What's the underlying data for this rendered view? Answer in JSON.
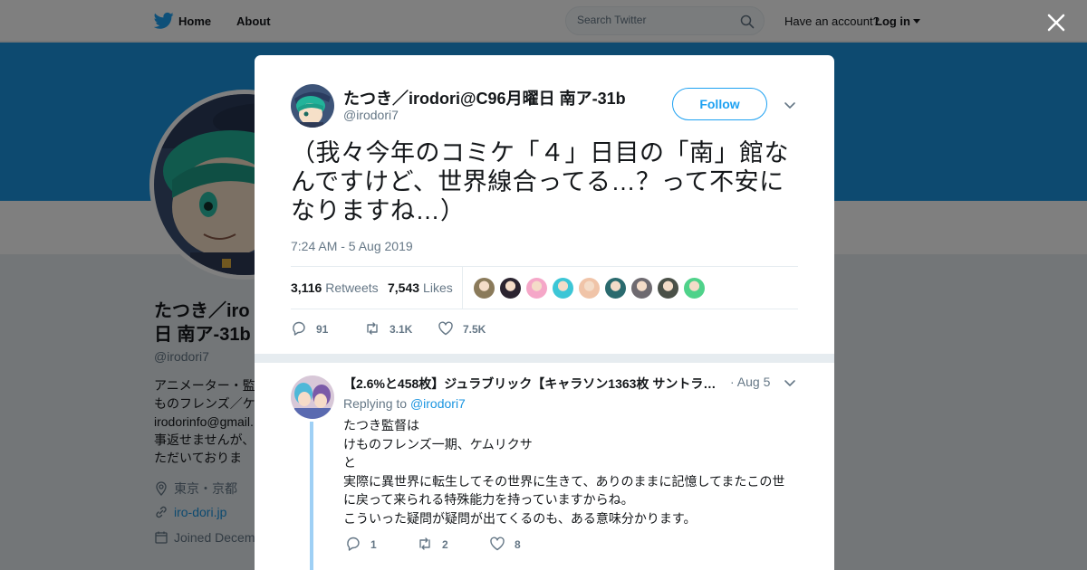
{
  "nav": {
    "home_label": "Home",
    "about_label": "About",
    "search_placeholder": "Search Twitter",
    "account_prompt": "Have an account?",
    "login_label": "Log in"
  },
  "background_profile": {
    "name_line1": "たつき／iro",
    "name_line2": "日 南ア-31b",
    "handle": "@irodori7",
    "bio_lines": [
      "アニメーター・監",
      "ものフレンズ／ケ",
      "irodorinfo@gmail.",
      "事返せませんが、",
      "ただいておりま"
    ],
    "location": "東京・京都",
    "website": "iro-dori.jp",
    "joined": "Joined Decem"
  },
  "tweet": {
    "author_name": "たつき／irodori@C96月曜日 南ア-31b",
    "author_handle": "@irodori7",
    "follow_label": "Follow",
    "text_lines": [
      "（我々今年のコミケ「４」日目の「南」館な",
      "んですけど、世界線合ってる…？って不安に",
      "なりますね…）"
    ],
    "timestamp": "7:24 AM - 5 Aug 2019",
    "retweet_count": "3,116",
    "retweets_label": "Retweets",
    "like_count": "7,543",
    "likes_label": "Likes",
    "reply_action_count": "91",
    "retweet_action_count": "3.1K",
    "like_action_count": "7.5K"
  },
  "likers": [
    "#8a7a5a",
    "#2b2430",
    "#f5a7c8",
    "#3cc6d6",
    "#f0c4a8",
    "#2a6a6e",
    "#6e6a70",
    "#4a5048",
    "#4fd28a"
  ],
  "reply": {
    "author_name": "【2.6%と458枚】ジュラブリック【キャラソン1363枚 サントラ…",
    "date": "· Aug 5",
    "replying_prefix": "Replying to",
    "replying_handle": "@irodori7",
    "text_lines": [
      "たつき監督は",
      "けものフレンズ一期、ケムリクサ",
      "と",
      "実際に異世界に転生してその世界に生きて、ありのままに記憶してまたこの世",
      "に戻って来られる特殊能力を持っていますからね。",
      "こういった疑問が疑問が出てくるのも、ある意味分かります。"
    ],
    "reply_count": "1",
    "retweet_count": "2",
    "like_count": "8"
  },
  "colors": {
    "twitter_blue": "#1da1f2",
    "banner_blue": "#1b95e0",
    "thread_line": "#9fd0f5",
    "secondary_text": "#657786"
  }
}
